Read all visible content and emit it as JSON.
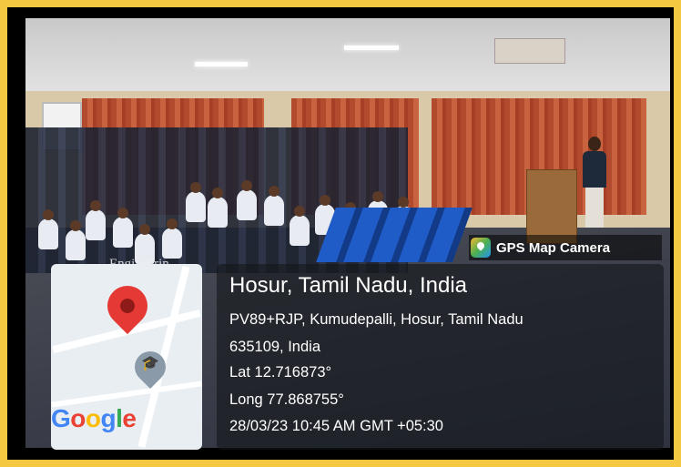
{
  "watermark": {
    "app_name": "GPS Map Camera",
    "icon": "gps-map-camera-icon"
  },
  "background_sign": "Engineerin",
  "map": {
    "pin_icon": "map-pin-icon",
    "poi_icon": "education-poi-icon",
    "logo_text": "Google"
  },
  "location": {
    "title": "Hosur, Tamil Nadu, India",
    "address_line1": "PV89+RJP, Kumudepalli, Hosur, Tamil Nadu",
    "address_line2": "635109, India",
    "lat": "Lat 12.716873°",
    "long": "Long 77.868755°",
    "datetime": "28/03/23 10:45 AM GMT +05:30"
  },
  "colors": {
    "frame": "#f5c842",
    "pin": "#e53935"
  }
}
